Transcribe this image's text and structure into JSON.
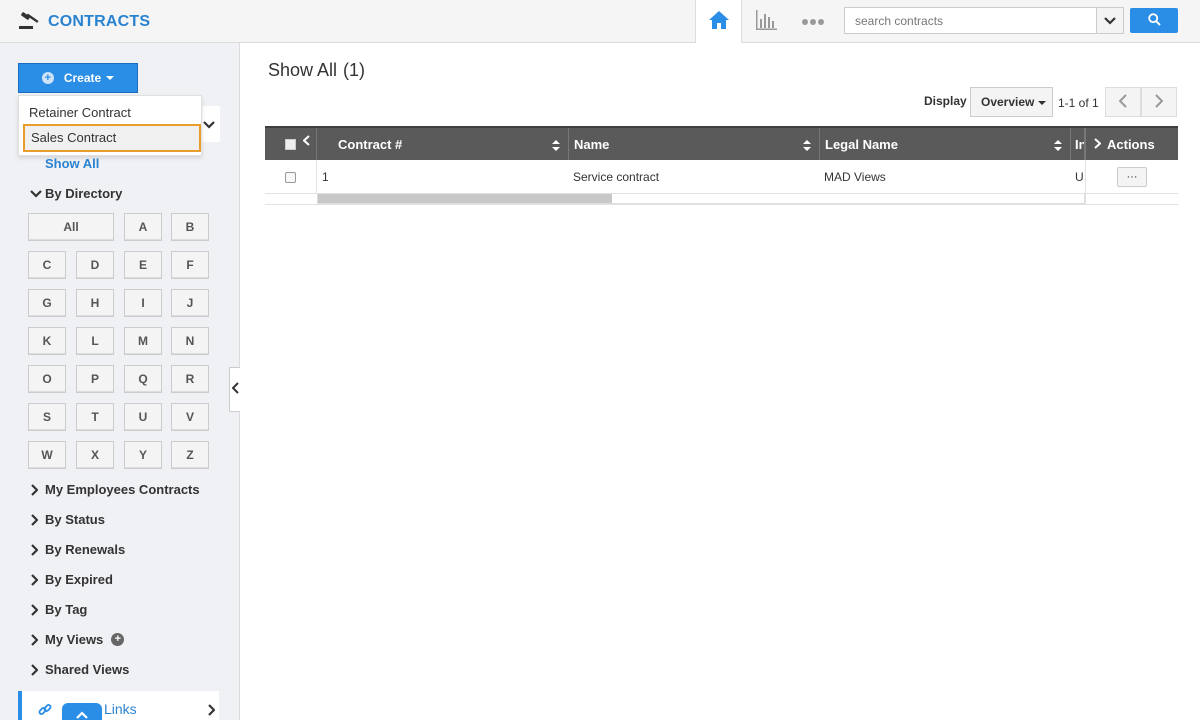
{
  "header": {
    "app_title": "CONTRACTS",
    "logo_icon": "gavel-icon",
    "nav": {
      "home_icon": "home-icon",
      "reports_icon": "bar-chart-icon",
      "more_icon": "more-dots-icon"
    },
    "search": {
      "placeholder": "search contracts",
      "value": ""
    },
    "accent_color": "#2b8ee6"
  },
  "sidebar": {
    "create_label": "Create",
    "create_menu": [
      "Retainer Contract",
      "Sales Contract"
    ],
    "create_menu_highlighted": "Sales Contract",
    "show_all": "Show All",
    "by_directory": "By Directory",
    "letters": [
      "All",
      "A",
      "B",
      "C",
      "D",
      "E",
      "F",
      "G",
      "H",
      "I",
      "J",
      "K",
      "L",
      "M",
      "N",
      "O",
      "P",
      "Q",
      "R",
      "S",
      "T",
      "U",
      "V",
      "W",
      "X",
      "Y",
      "Z"
    ],
    "sections": [
      "My Employees Contracts",
      "By Status",
      "By Renewals",
      "By Expired",
      "By Tag",
      "My Views",
      "Shared Views"
    ],
    "quick_links": "Links"
  },
  "main": {
    "title": "Show All",
    "count": "(1)",
    "display_label": "Display",
    "display_value": "Overview",
    "pager_text": "1-1 of 1",
    "columns": [
      "Contract #",
      "Name",
      "Legal Name",
      "In",
      "Actions"
    ],
    "rows": [
      {
        "contract_no": "1",
        "name": "Service contract",
        "legal_name": "MAD Views",
        "in": "U",
        "actions": "···"
      }
    ]
  }
}
